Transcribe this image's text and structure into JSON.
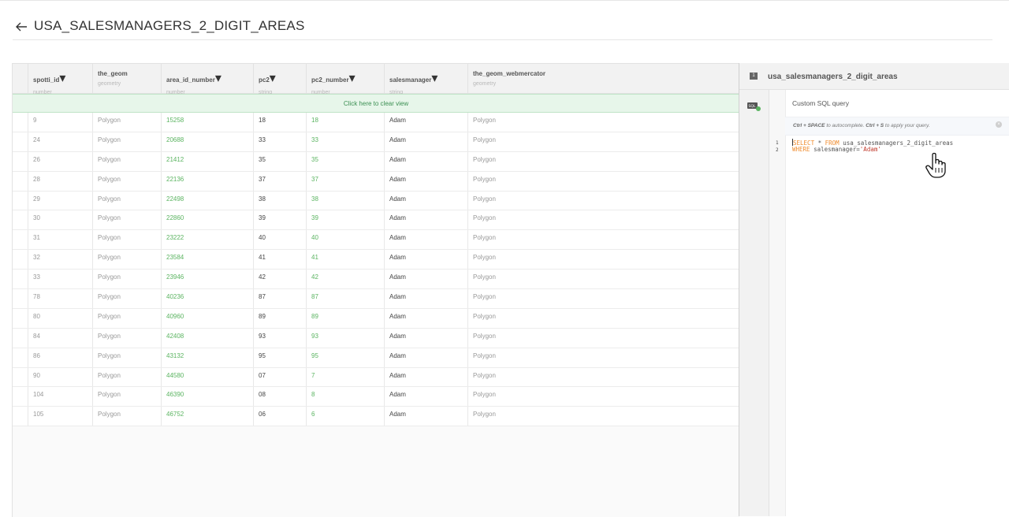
{
  "header": {
    "title": "USA_SALESMANAGERS_2_DIGIT_AREAS"
  },
  "table": {
    "columns": [
      {
        "name": "spotti_id",
        "type": "number",
        "sortable": true
      },
      {
        "name": "the_geom",
        "type": "geometry",
        "sortable": false
      },
      {
        "name": "area_id_number",
        "type": "number",
        "sortable": true
      },
      {
        "name": "pc2",
        "type": "string",
        "sortable": true
      },
      {
        "name": "pc2_number",
        "type": "number",
        "sortable": true
      },
      {
        "name": "salesmanager",
        "type": "string",
        "sortable": true
      },
      {
        "name": "the_geom_webmercator",
        "type": "geometry",
        "sortable": false
      }
    ],
    "clear_view_label": "Click here to clear view",
    "rows": [
      [
        "9",
        "Polygon",
        "15258",
        "18",
        "18",
        "Adam",
        "Polygon"
      ],
      [
        "24",
        "Polygon",
        "20688",
        "33",
        "33",
        "Adam",
        "Polygon"
      ],
      [
        "26",
        "Polygon",
        "21412",
        "35",
        "35",
        "Adam",
        "Polygon"
      ],
      [
        "28",
        "Polygon",
        "22136",
        "37",
        "37",
        "Adam",
        "Polygon"
      ],
      [
        "29",
        "Polygon",
        "22498",
        "38",
        "38",
        "Adam",
        "Polygon"
      ],
      [
        "30",
        "Polygon",
        "22860",
        "39",
        "39",
        "Adam",
        "Polygon"
      ],
      [
        "31",
        "Polygon",
        "23222",
        "40",
        "40",
        "Adam",
        "Polygon"
      ],
      [
        "32",
        "Polygon",
        "23584",
        "41",
        "41",
        "Adam",
        "Polygon"
      ],
      [
        "33",
        "Polygon",
        "23946",
        "42",
        "42",
        "Adam",
        "Polygon"
      ],
      [
        "78",
        "Polygon",
        "40236",
        "87",
        "87",
        "Adam",
        "Polygon"
      ],
      [
        "80",
        "Polygon",
        "40960",
        "89",
        "89",
        "Adam",
        "Polygon"
      ],
      [
        "84",
        "Polygon",
        "42408",
        "93",
        "93",
        "Adam",
        "Polygon"
      ],
      [
        "86",
        "Polygon",
        "43132",
        "95",
        "95",
        "Adam",
        "Polygon"
      ],
      [
        "90",
        "Polygon",
        "44580",
        "07",
        "7",
        "Adam",
        "Polygon"
      ],
      [
        "104",
        "Polygon",
        "46390",
        "08",
        "8",
        "Adam",
        "Polygon"
      ],
      [
        "105",
        "Polygon",
        "46752",
        "06",
        "6",
        "Adam",
        "Polygon"
      ]
    ]
  },
  "panel": {
    "layer_number": "1",
    "layer_name": "usa_salesmanagers_2_digit_areas",
    "sql_title": "Custom SQL query",
    "hint": {
      "shortcut1": "Ctrl + SPACE",
      "text1": " to autocomplete. ",
      "shortcut2": "Ctrl + S",
      "text2": " to apply your query."
    },
    "editor": {
      "line1_no": "1",
      "line2_no": "2",
      "kw_select": "SELECT",
      "star": " * ",
      "kw_from": "FROM",
      "table": " usa_salesmanagers_2_digit_areas",
      "kw_where": "WHERE",
      "cond": " salesmanager=",
      "value": "'Adam'"
    }
  },
  "colors": {
    "accent_green": "#5bb461",
    "banner_bg": "#e7f6ea",
    "keyword": "#f08c2e",
    "string": "#c0392b"
  },
  "icons": [
    "back-arrow-icon",
    "sort-caret-icon",
    "sql-icon",
    "close-icon",
    "hand-cursor-icon"
  ]
}
